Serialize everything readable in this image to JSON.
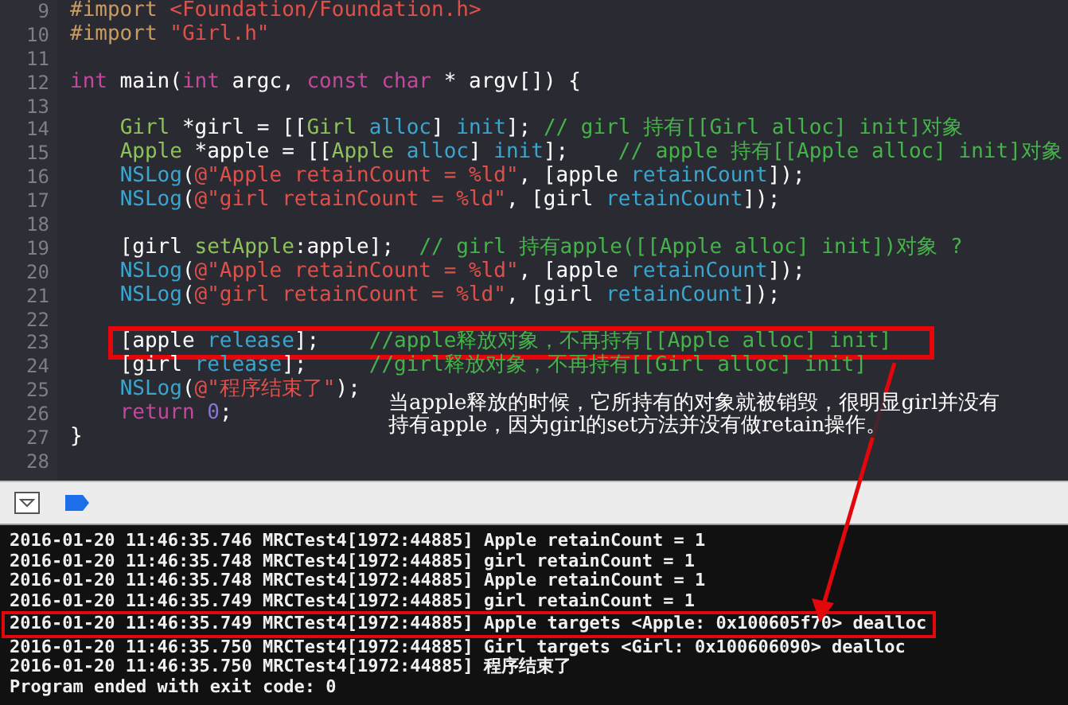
{
  "editor": {
    "lines": [
      {
        "number": "9",
        "tokens": [
          {
            "kind": "preprocessor",
            "text": "#import "
          },
          {
            "kind": "string",
            "text": "<Foundation/Foundation.h>"
          }
        ]
      },
      {
        "number": "10",
        "tokens": [
          {
            "kind": "preprocessor",
            "text": "#import "
          },
          {
            "kind": "string",
            "text": "\"Girl.h\""
          }
        ]
      },
      {
        "number": "11"
      },
      {
        "number": "12",
        "tokens": [
          {
            "kind": "keyword",
            "text": "int"
          },
          {
            "kind": "plain",
            "text": " main("
          },
          {
            "kind": "keyword",
            "text": "int"
          },
          {
            "kind": "plain",
            "text": " argc, "
          },
          {
            "kind": "keyword",
            "text": "const char"
          },
          {
            "kind": "plain",
            "text": " * argv[]) {"
          }
        ]
      },
      {
        "number": "13"
      },
      {
        "number": "14",
        "tokens": [
          {
            "kind": "project",
            "text": "    Girl"
          },
          {
            "kind": "plain",
            "text": " *girl = [["
          },
          {
            "kind": "project",
            "text": "Girl"
          },
          {
            "kind": "method",
            "text": " alloc"
          },
          {
            "kind": "plain",
            "text": "] "
          },
          {
            "kind": "method",
            "text": "init"
          },
          {
            "kind": "plain",
            "text": "]; "
          },
          {
            "kind": "comment",
            "text": "// girl 持有[[Girl alloc] init]对象"
          }
        ]
      },
      {
        "number": "15",
        "tokens": [
          {
            "kind": "project",
            "text": "    Apple"
          },
          {
            "kind": "plain",
            "text": " *apple = [["
          },
          {
            "kind": "project",
            "text": "Apple"
          },
          {
            "kind": "method",
            "text": " alloc"
          },
          {
            "kind": "plain",
            "text": "] "
          },
          {
            "kind": "method",
            "text": "init"
          },
          {
            "kind": "plain",
            "text": "];    "
          },
          {
            "kind": "comment",
            "text": "// apple 持有[[Apple alloc] init]对象"
          }
        ]
      },
      {
        "number": "16",
        "tokens": [
          {
            "kind": "method",
            "text": "    NSLog"
          },
          {
            "kind": "plain",
            "text": "("
          },
          {
            "kind": "string",
            "text": "@\"Apple retainCount = %ld\""
          },
          {
            "kind": "plain",
            "text": ", [apple "
          },
          {
            "kind": "method",
            "text": "retainCount"
          },
          {
            "kind": "plain",
            "text": "]);"
          }
        ]
      },
      {
        "number": "17",
        "tokens": [
          {
            "kind": "method",
            "text": "    NSLog"
          },
          {
            "kind": "plain",
            "text": "("
          },
          {
            "kind": "string",
            "text": "@\"girl retainCount = %ld\""
          },
          {
            "kind": "plain",
            "text": ", [girl "
          },
          {
            "kind": "method",
            "text": "retainCount"
          },
          {
            "kind": "plain",
            "text": "]);"
          }
        ]
      },
      {
        "number": "18"
      },
      {
        "number": "19",
        "tokens": [
          {
            "kind": "plain",
            "text": "    [girl "
          },
          {
            "kind": "project",
            "text": "setApple"
          },
          {
            "kind": "plain",
            "text": ":apple];  "
          },
          {
            "kind": "comment",
            "text": "// girl 持有apple([[Apple alloc] init])对象 ?"
          }
        ]
      },
      {
        "number": "20",
        "tokens": [
          {
            "kind": "method",
            "text": "    NSLog"
          },
          {
            "kind": "plain",
            "text": "("
          },
          {
            "kind": "string",
            "text": "@\"Apple retainCount = %ld\""
          },
          {
            "kind": "plain",
            "text": ", [apple "
          },
          {
            "kind": "method",
            "text": "retainCount"
          },
          {
            "kind": "plain",
            "text": "]);"
          }
        ]
      },
      {
        "number": "21",
        "tokens": [
          {
            "kind": "method",
            "text": "    NSLog"
          },
          {
            "kind": "plain",
            "text": "("
          },
          {
            "kind": "string",
            "text": "@\"girl retainCount = %ld\""
          },
          {
            "kind": "plain",
            "text": ", [girl "
          },
          {
            "kind": "method",
            "text": "retainCount"
          },
          {
            "kind": "plain",
            "text": "]);"
          }
        ]
      },
      {
        "number": "22"
      },
      {
        "number": "23",
        "boxed": true,
        "tokens": [
          {
            "kind": "plain",
            "text": "    [apple "
          },
          {
            "kind": "method",
            "text": "release"
          },
          {
            "kind": "plain",
            "text": "];    "
          },
          {
            "kind": "comment",
            "text": "//apple释放对象，不再持有[[Apple alloc] init]"
          }
        ]
      },
      {
        "number": "24",
        "tokens": [
          {
            "kind": "plain",
            "text": "    [girl "
          },
          {
            "kind": "method",
            "text": "release"
          },
          {
            "kind": "plain",
            "text": "];     "
          },
          {
            "kind": "comment",
            "text": "//girl释放对象，不再持有[[Girl alloc] init]"
          }
        ]
      },
      {
        "number": "25",
        "tokens": [
          {
            "kind": "method",
            "text": "    NSLog"
          },
          {
            "kind": "plain",
            "text": "("
          },
          {
            "kind": "string",
            "text": "@\"程序结束了\""
          },
          {
            "kind": "plain",
            "text": ");"
          }
        ]
      },
      {
        "number": "26",
        "tokens": [
          {
            "kind": "keyword",
            "text": "    return"
          },
          {
            "kind": "number",
            "text": " 0"
          },
          {
            "kind": "plain",
            "text": ";"
          }
        ]
      },
      {
        "number": "27",
        "tokens": [
          {
            "kind": "plain",
            "text": "}"
          }
        ]
      },
      {
        "number": "28"
      }
    ]
  },
  "annotation": {
    "lines": [
      "当apple释放的时候，它所持有的对象就被销毁，很明显girl并没有",
      "持有apple，因为girl的set方法并没有做retain操作。"
    ]
  },
  "console": {
    "lines": [
      {
        "text": "2016-01-20 11:46:35.746 MRCTest4[1972:44885] Apple retainCount = 1"
      },
      {
        "text": "2016-01-20 11:46:35.748 MRCTest4[1972:44885] girl retainCount = 1"
      },
      {
        "text": "2016-01-20 11:46:35.748 MRCTest4[1972:44885] Apple retainCount = 1"
      },
      {
        "text": "2016-01-20 11:46:35.749 MRCTest4[1972:44885] girl retainCount = 1"
      },
      {
        "text": "2016-01-20 11:46:35.749 MRCTest4[1972:44885] Apple targets <Apple: 0x100605f70> dealloc",
        "boxed": true
      },
      {
        "text": "2016-01-20 11:46:35.750 MRCTest4[1972:44885] Girl targets <Girl: 0x100606090> dealloc"
      },
      {
        "text": "2016-01-20 11:46:35.750 MRCTest4[1972:44885] 程序结束了"
      },
      {
        "text": "Program ended with exit code: 0"
      }
    ]
  }
}
